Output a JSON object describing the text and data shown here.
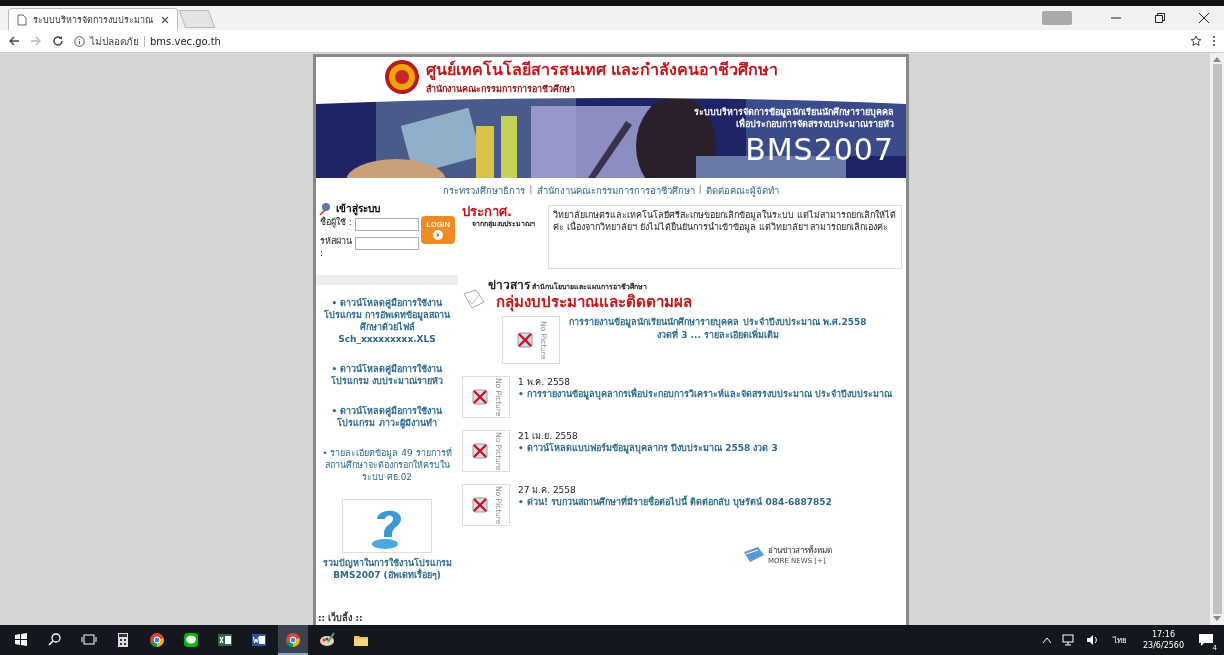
{
  "browser": {
    "tab_title": "ระบบบริหารจัดการงบประมาณ",
    "security": "ไม่ปลอดภัย",
    "url": "bms.vec.go.th"
  },
  "header": {
    "title": "ศูนย์เทคโนโลยีสารสนเทศ และกำลังคนอาชีวศึกษา",
    "subtitle": "สำนักงานคณะกรรมการการอาชีวศึกษา"
  },
  "banner": {
    "lines": [
      "ระบบบริหารจัดการข้อมูลนักเรียนนักศึกษารายบุคคล",
      "เพื่อประกอบการจัดสรรงบประมาณรายหัว"
    ],
    "product": "BMS2007",
    "kind": "picture"
  },
  "nav": [
    {
      "kind": "link",
      "text": "กระทรวงศึกษาธิการ"
    },
    {
      "kind": "separator",
      "text": "|"
    },
    {
      "kind": "link",
      "text": "สำนักงานคณะกรรมการการอาชีวศึกษา"
    },
    {
      "kind": "separator",
      "text": "|"
    },
    {
      "kind": "link",
      "text": "ติดต่อคณะผู้จัดทำ"
    }
  ],
  "login": {
    "title": "เข้าสู่ระบบ",
    "fields": [
      {
        "label": "ชื่อผู้ใช้ :"
      },
      {
        "label": "รหัสผ่าน :"
      }
    ],
    "button": "LOGIN"
  },
  "announcement": {
    "heading": "ประกาศ.",
    "source": "จากกลุ่มงบประมาณฯ",
    "text": "วิทยาลัยเกษตรและเทคโนโลยีศรีสะเกษขอยกเลิกข้อมูลในระบบ แต่ไม่สามารถยกเลิกให้ได้ค่ะ เนื่องจากวิทยาลัยฯ ยังไม่ได้ยืนยันการนำเข้าข้อมูล แต่วิทยาลัยฯ สามารถยกเลิกเองค่ะ"
  },
  "sidebar": {
    "links": [
      {
        "text": "• ดาวน์โหลดคู่มือการใช้งานโปรแกรม การอัพเดทข้อมูลสถานศึกษาด้วยไฟล์ Sch_xxxxxxxxx.XLS",
        "bold": true
      },
      {
        "text": "• ดาวน์โหลดคู่มือการใช้งานโปรแกรม งบประมาณรายหัว",
        "bold": true
      },
      {
        "text": "• ดาวน์โหลดคู่มือการใช้งานโปรแกรม ภาวะผู้มีงานทำ",
        "bold": true
      },
      {
        "text": "• รายละเอียดข้อมูล 49 รายการที่สถานศึกษาจะต้องกรอกให้ครบในระบบ ศธ.02",
        "bold": false
      }
    ],
    "help": "รวมปัญหาในการใช้งานโปรแกรม BMS2007 (อัพเดทเรื่อยๆ)",
    "section": ":: เว็บลิ้ง ::"
  },
  "news": {
    "heading": "ข่าวสาร",
    "department": "สำนักนโยบายและแผนการอาชีวศึกษา",
    "group": "กลุ่มงบประมาณและติดตามผล",
    "featured": {
      "image": "No Picture",
      "text": "การรายงานข้อมูลนักเรียนนักศึกษารายบุคคล ประจำปีงบประมาณ พ.ศ.2558 งวดที่ 3 ... รายละเอียดเพิ่มเติม"
    },
    "items": [
      {
        "image": "No Picture",
        "date": "1 พ.ค. 2558",
        "text": "• การรายงานข้อมูลบุคลากรเพื่อประกอบการวิเคราะห์และจัดสรรงบประมาณ ประจำปีงบประมาณ"
      },
      {
        "image": "No Picture",
        "date": "21 เม.ย. 2558",
        "text": "• ดาวน์โหลดแบบฟอร์มข้อมูลบุคลากร ปีงบประมาณ 2558 งวด 3"
      },
      {
        "image": "No Picture",
        "date": "27 ม.ค. 2558",
        "text": "• ด่วน! รบกวนสถานศึกษาที่มีรายชื่อต่อไปนี้ ติดต่อกลับ บุษรัตน์ 084-6887852"
      }
    ],
    "more": {
      "title": "อ่านข่าวสารทั้งหมด",
      "subtitle": "MORE NEWS [+]"
    }
  },
  "taskbar": {
    "apps": [
      {
        "kind": "start",
        "selected": false
      },
      {
        "kind": "search",
        "selected": false
      },
      {
        "kind": "taskview",
        "selected": false
      },
      {
        "kind": "calculator",
        "selected": false
      },
      {
        "kind": "chrome",
        "selected": false
      },
      {
        "kind": "chat",
        "selected": false
      },
      {
        "kind": "spreadsheet",
        "selected": false
      },
      {
        "kind": "document",
        "selected": false
      },
      {
        "kind": "chrome",
        "selected": true
      },
      {
        "kind": "paint",
        "selected": false
      },
      {
        "kind": "folder",
        "selected": false
      }
    ],
    "language": "ไทย",
    "time": "17:16",
    "date": "23/6/2560",
    "notifications": "4"
  }
}
